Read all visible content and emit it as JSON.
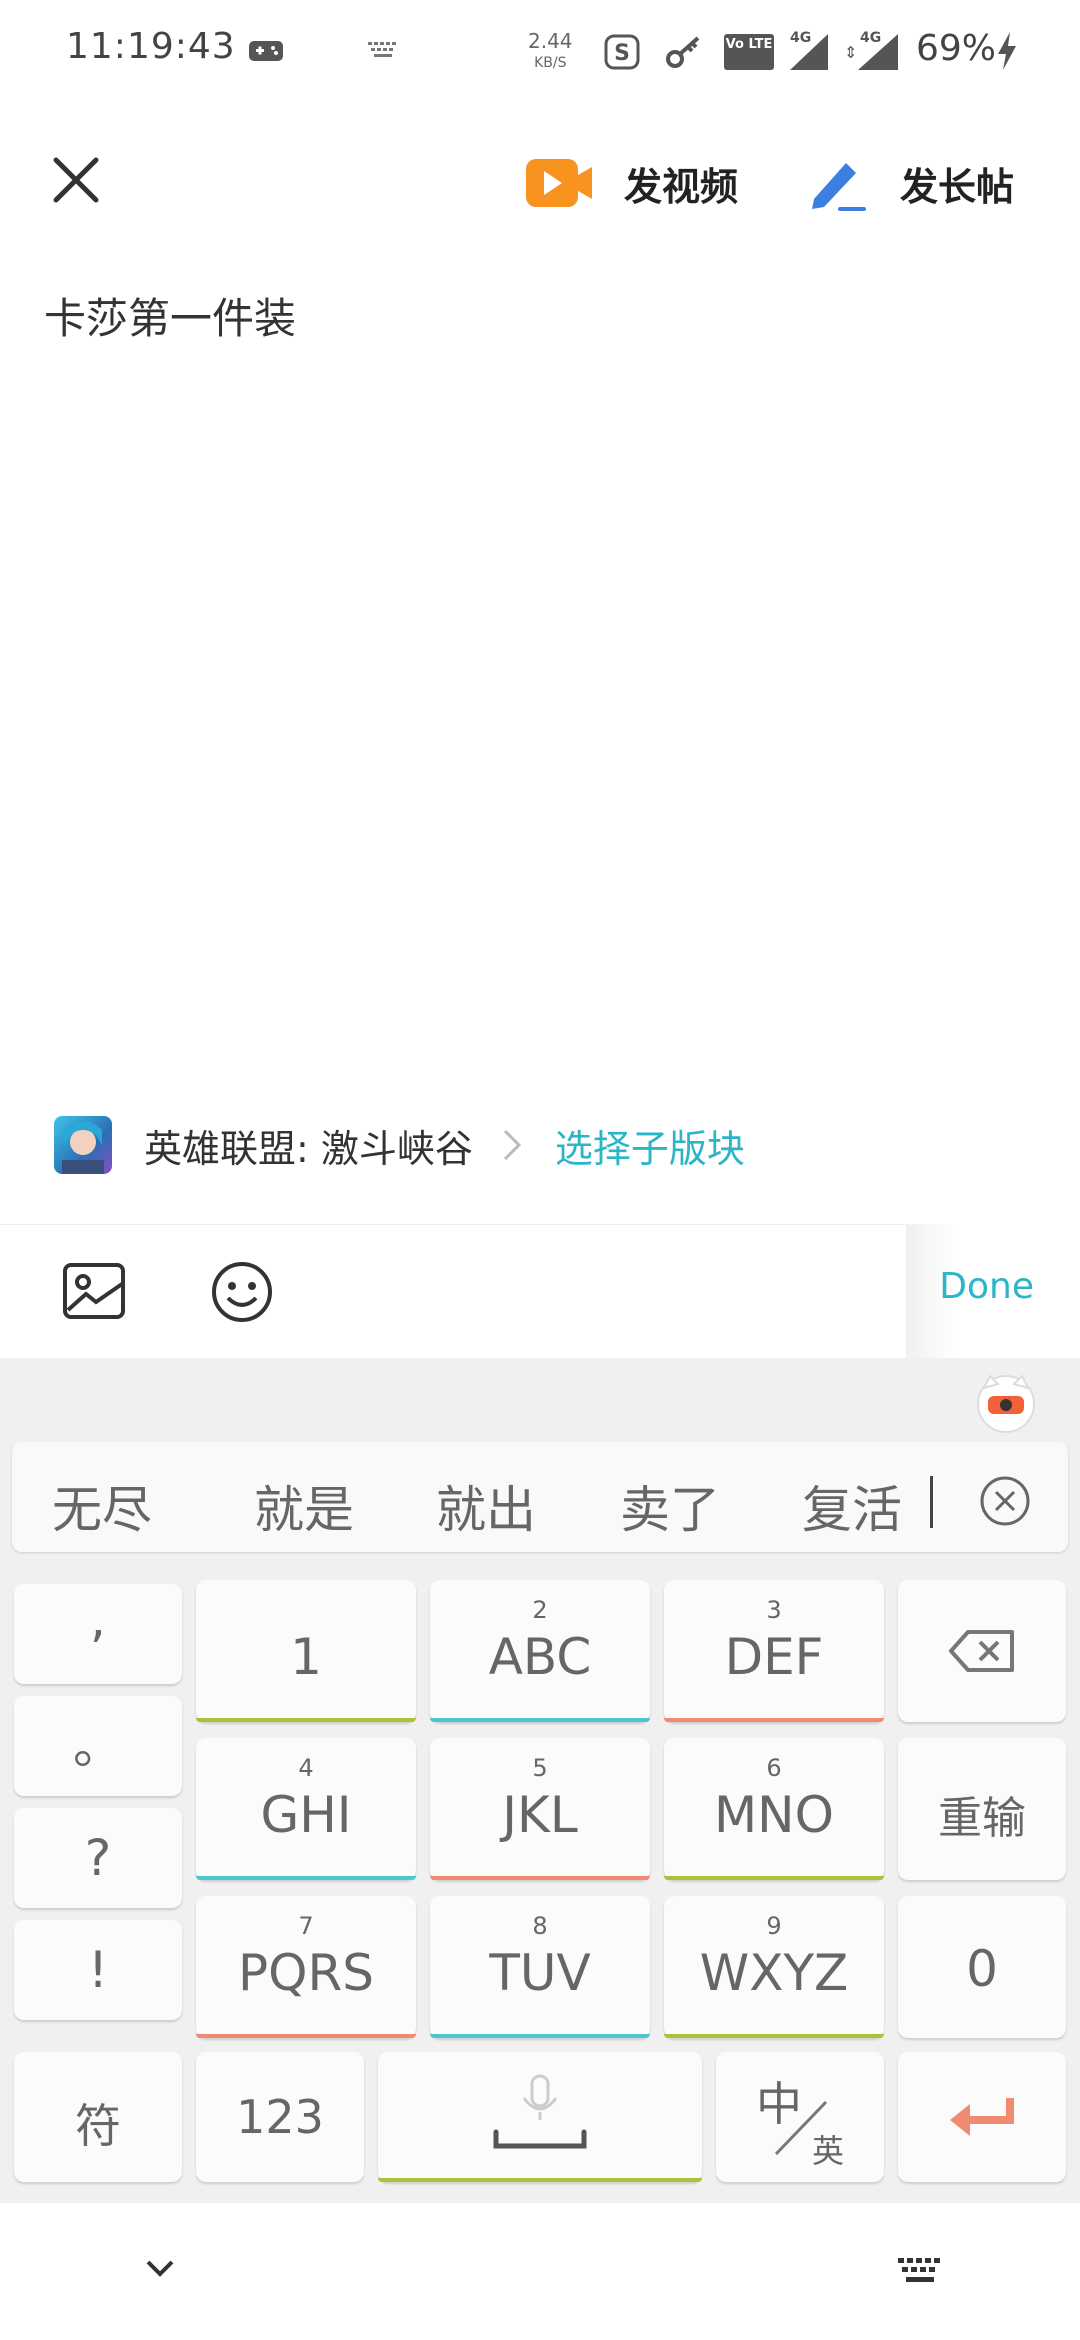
{
  "status_bar": {
    "time": "11:19:43",
    "net_speed_value": "2.44",
    "net_speed_unit": "KB/S",
    "network_type_1": "4G",
    "network_type_2": "4G",
    "volte_label": "Vo LTE",
    "battery_percent": "69%"
  },
  "header": {
    "video_label": "发视频",
    "long_post_label": "发长帖"
  },
  "editor": {
    "text": "卡莎第一件装"
  },
  "forum": {
    "name": "英雄联盟: 激斗峡谷",
    "sub_section_link": "选择子版块"
  },
  "toolbar": {
    "done_label": "Done"
  },
  "keyboard": {
    "candidates": [
      "无尽",
      "就是",
      "就出",
      "卖了",
      "复活"
    ],
    "punctuation": [
      ",",
      "。",
      "?",
      "!"
    ],
    "keys": [
      {
        "num": "",
        "letters": "1"
      },
      {
        "num": "2",
        "letters": "ABC"
      },
      {
        "num": "3",
        "letters": "DEF"
      },
      {
        "num": "4",
        "letters": "GHI"
      },
      {
        "num": "5",
        "letters": "JKL"
      },
      {
        "num": "6",
        "letters": "MNO"
      },
      {
        "num": "7",
        "letters": "PQRS"
      },
      {
        "num": "8",
        "letters": "TUV"
      },
      {
        "num": "9",
        "letters": "WXYZ"
      }
    ],
    "reenter_label": "重输",
    "zero_label": "0",
    "symbol_label": "符",
    "num_label": "123",
    "lang_zh": "中",
    "lang_en": "英"
  },
  "colors": {
    "accent_teal": "#2bb5c6",
    "video_orange": "#f7931e",
    "pen_blue": "#3d7fe0",
    "enter_orange": "#f08a70"
  }
}
